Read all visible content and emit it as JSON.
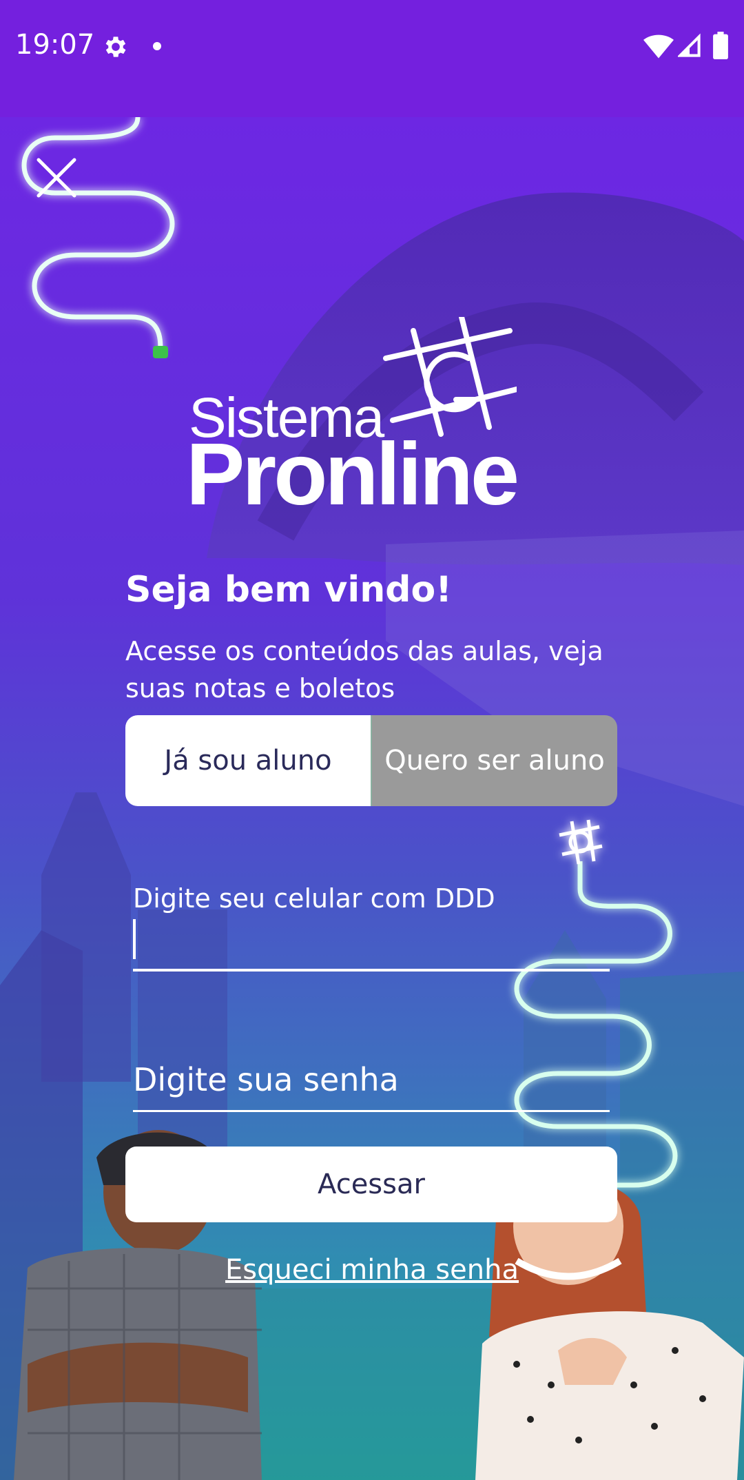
{
  "status_bar": {
    "time": "19:07",
    "icons": [
      "gear-icon",
      "notification-dot-icon",
      "wifi-icon",
      "signal-icon",
      "battery-icon"
    ]
  },
  "close_icon": "close-icon",
  "logo": {
    "line1": "Sistema",
    "line2": "Pronline"
  },
  "welcome": {
    "title": "Seja bem vindo!",
    "subtitle": "Acesse os conteúdos das aulas, veja suas notas e boletos"
  },
  "segment": {
    "active": "Já sou aluno",
    "inactive": "Quero ser aluno"
  },
  "form": {
    "phone_label": "Digite seu celular com DDD",
    "phone_value": "",
    "password_placeholder": "Digite sua senha",
    "submit_label": "Acessar",
    "forgot_label": "Esqueci minha senha"
  },
  "colors": {
    "status_bar": "#7420de",
    "bg_top": "#6d27e3",
    "bg_bottom": "#22a49a",
    "neon_line": "#4dffb0",
    "segment_inactive": "#9a9a9a",
    "button_text": "#2a2a55"
  }
}
